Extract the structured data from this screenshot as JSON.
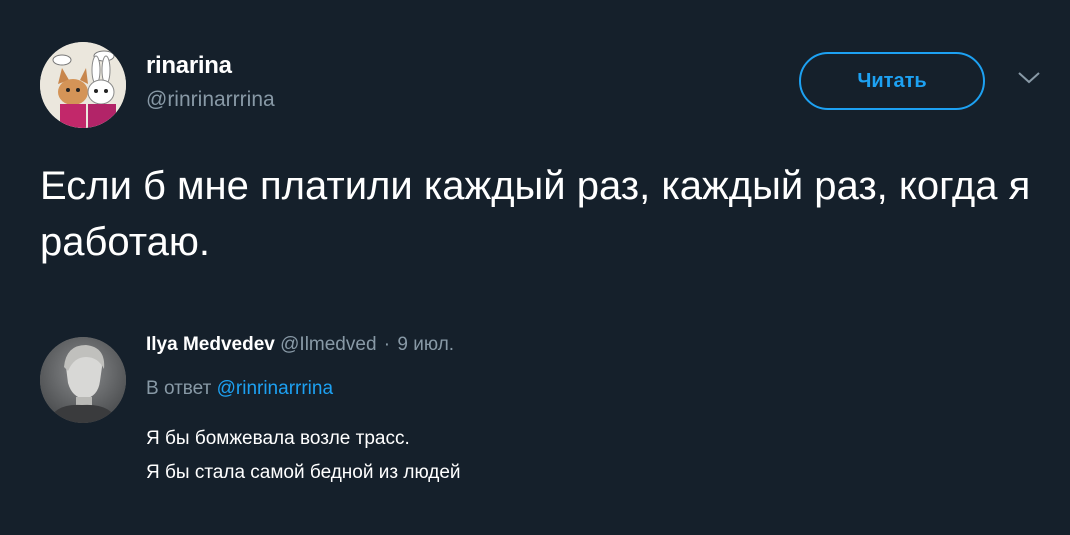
{
  "tweet": {
    "author": {
      "display_name": "rinarina",
      "username": "@rinrinarrrina"
    },
    "follow_button_label": "Читать",
    "text": "Если б мне платили каждый раз, каждый раз, когда я работаю."
  },
  "reply": {
    "author": {
      "display_name": "Ilya Medvedev",
      "username": "@Ilmedved"
    },
    "separator": "·",
    "date": "9 июл.",
    "in_reply_to_prefix": "В ответ",
    "in_reply_to_mention": "@rinrinarrrina",
    "lines": [
      "Я бы бомжевала возле трасс.",
      "Я бы стала самой бедной из людей"
    ]
  },
  "colors": {
    "background": "#15202b",
    "accent": "#1da1f2",
    "secondary_text": "#8899a6",
    "primary_text": "#ffffff"
  },
  "icons": {
    "more": "chevron-down-icon"
  }
}
